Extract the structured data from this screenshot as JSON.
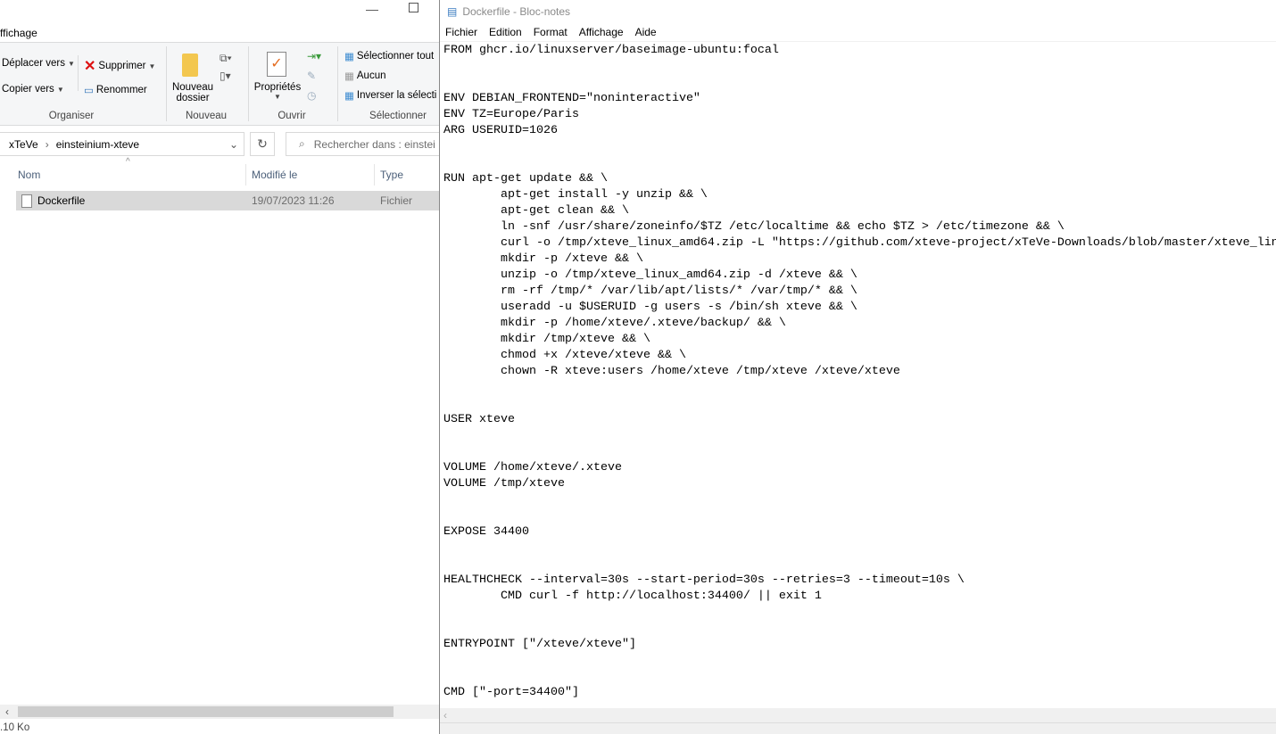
{
  "explorer": {
    "tab_label": "ffichage",
    "ribbon": {
      "move_to": "Déplacer vers",
      "copy_to": "Copier vers",
      "delete": "Supprimer",
      "rename": "Renommer",
      "group_organize": "Organiser",
      "new_folder_line1": "Nouveau",
      "new_folder_line2": "dossier",
      "group_new": "Nouveau",
      "properties": "Propriétés",
      "group_open": "Ouvrir",
      "select_all": "Sélectionner tout",
      "select_none": "Aucun",
      "invert_selection": "Inverser la sélecti",
      "group_select": "Sélectionner"
    },
    "breadcrumb": [
      "xTeVe",
      "einsteinium-xteve"
    ],
    "search_placeholder": "Rechercher dans : einstei",
    "columns": {
      "name": "Nom",
      "modified": "Modifié le",
      "type": "Type"
    },
    "files": [
      {
        "name": "Dockerfile",
        "modified": "19/07/2023 11:26",
        "type": "Fichier"
      }
    ],
    "status": ".10 Ko"
  },
  "notepad": {
    "title": "Dockerfile - Bloc-notes",
    "menu": [
      "Fichier",
      "Edition",
      "Format",
      "Affichage",
      "Aide"
    ],
    "lines": [
      "FROM ghcr.io/linuxserver/baseimage-ubuntu:focal",
      "",
      "",
      "ENV DEBIAN_FRONTEND=\"noninteractive\"",
      "ENV TZ=Europe/Paris",
      "ARG USERUID=1026",
      "",
      "",
      "RUN apt-get update && \\",
      "        apt-get install -y unzip && \\",
      "        apt-get clean && \\",
      "        ln -snf /usr/share/zoneinfo/$TZ /etc/localtime && echo $TZ > /etc/timezone && \\",
      "        curl -o /tmp/xteve_linux_amd64.zip -L \"https://github.com/xteve-project/xTeVe-Downloads/blob/master/xteve_lin",
      "        mkdir -p /xteve && \\",
      "        unzip -o /tmp/xteve_linux_amd64.zip -d /xteve && \\",
      "        rm -rf /tmp/* /var/lib/apt/lists/* /var/tmp/* && \\",
      "        useradd -u $USERUID -g users -s /bin/sh xteve && \\",
      "        mkdir -p /home/xteve/.xteve/backup/ && \\",
      "        mkdir /tmp/xteve && \\",
      "        chmod +x /xteve/xteve && \\",
      "        chown -R xteve:users /home/xteve /tmp/xteve /xteve/xteve",
      "",
      "",
      "USER xteve",
      "",
      "",
      "VOLUME /home/xteve/.xteve",
      "VOLUME /tmp/xteve",
      "",
      "",
      "EXPOSE 34400",
      "",
      "",
      "HEALTHCHECK --interval=30s --start-period=30s --retries=3 --timeout=10s \\",
      "        CMD curl -f http://localhost:34400/ || exit 1",
      "",
      "",
      "ENTRYPOINT [\"/xteve/xteve\"]",
      "",
      "",
      "CMD [\"-port=34400\"]"
    ]
  }
}
